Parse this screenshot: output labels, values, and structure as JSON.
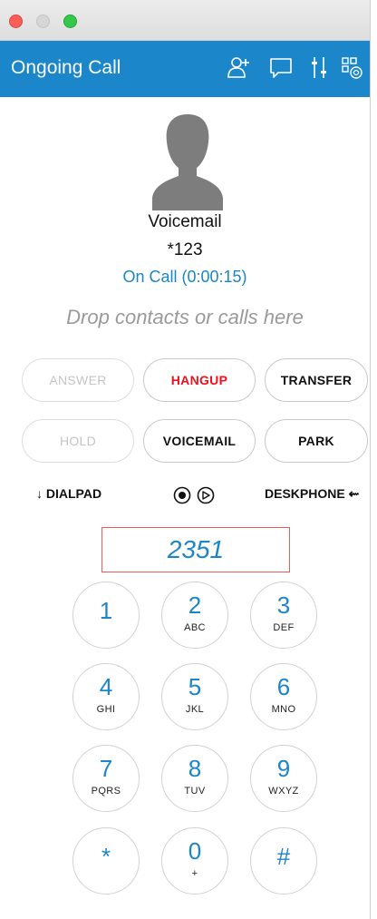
{
  "header": {
    "title": "Ongoing Call"
  },
  "contact": {
    "name": "Voicemail",
    "number": "*123",
    "status": "On Call (0:00:15)"
  },
  "drop_hint": "Drop contacts or calls here",
  "call_buttons": {
    "answer": "ANSWER",
    "hangup": "HANGUP",
    "transfer": "TRANSFER",
    "hold": "HOLD",
    "voicemail": "VOICEMAIL",
    "park": "PARK"
  },
  "toggles": {
    "dialpad": "↓ DIALPAD",
    "deskphone": "DESKPHONE ⇜"
  },
  "dial_input": {
    "value": "2351"
  },
  "keys": [
    {
      "digit": "1",
      "letters": ""
    },
    {
      "digit": "2",
      "letters": "ABC"
    },
    {
      "digit": "3",
      "letters": "DEF"
    },
    {
      "digit": "4",
      "letters": "GHI"
    },
    {
      "digit": "5",
      "letters": "JKL"
    },
    {
      "digit": "6",
      "letters": "MNO"
    },
    {
      "digit": "7",
      "letters": "PQRS"
    },
    {
      "digit": "8",
      "letters": "TUV"
    },
    {
      "digit": "9",
      "letters": "WXYZ"
    },
    {
      "digit": "*",
      "letters": ""
    },
    {
      "digit": "0",
      "letters": "+"
    },
    {
      "digit": "#",
      "letters": ""
    }
  ],
  "icons": {
    "header": [
      "add-contact-icon",
      "chat-icon",
      "audio-settings-icon",
      "qr-scan-icon"
    ],
    "record": "record-icon",
    "play": "play-icon",
    "avatar": "person-silhouette-icon"
  },
  "colors": {
    "brand": "#1b86c9",
    "hangup": "#e8131b",
    "input_border": "#e0605c",
    "muted": "#9a9a9a"
  }
}
